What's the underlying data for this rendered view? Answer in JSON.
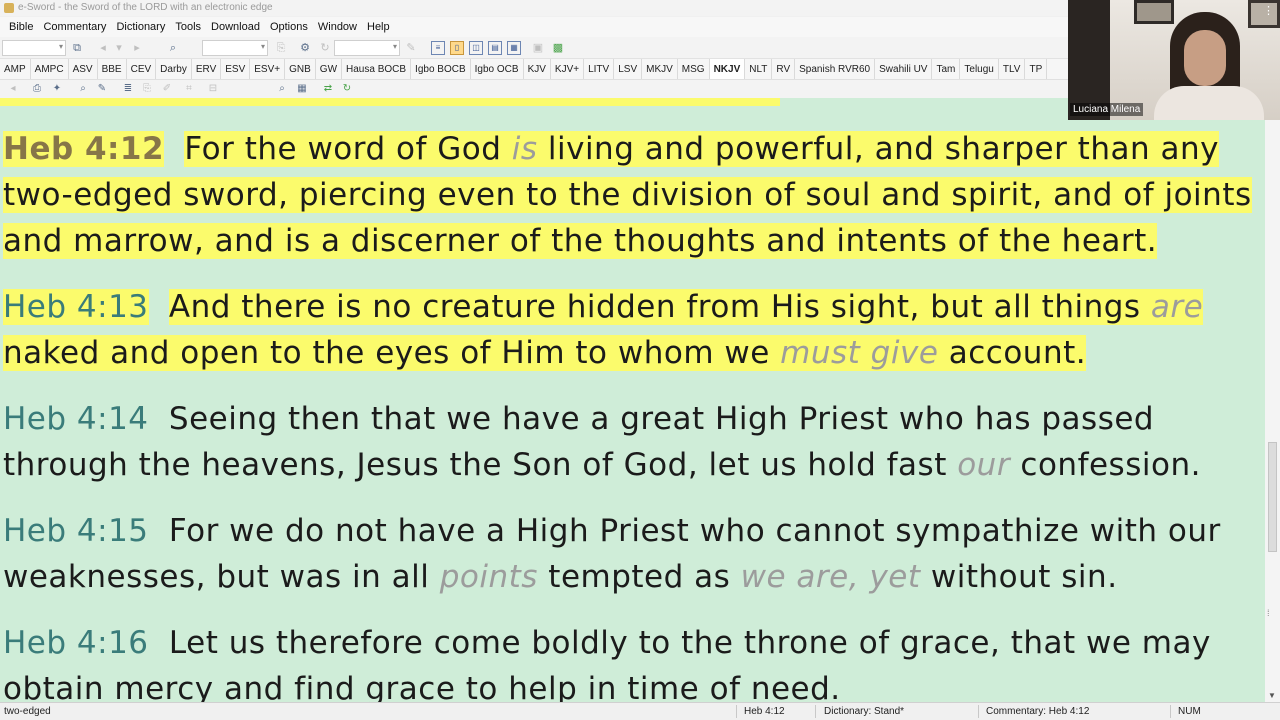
{
  "window": {
    "title": "e-Sword - the Sword of the LORD with an electronic edge"
  },
  "menu": [
    "Bible",
    "Commentary",
    "Dictionary",
    "Tools",
    "Download",
    "Options",
    "Window",
    "Help"
  ],
  "bible_tabs": [
    "AMP",
    "AMPC",
    "ASV",
    "BBE",
    "CEV",
    "Darby",
    "ERV",
    "ESV",
    "ESV+",
    "GNB",
    "GW",
    "Hausa BOCB",
    "Igbo BOCB",
    "Igbo OCB",
    "KJV",
    "KJV+",
    "LITV",
    "LSV",
    "MKJV",
    "MSG",
    "NKJV",
    "NLT",
    "RV",
    "Spanish RVR60",
    "Swahili UV",
    "Tam",
    "Telugu",
    "TLV",
    "TP"
  ],
  "active_tab": "NKJV",
  "verses": [
    {
      "ref": "Heb 4:12",
      "segments": [
        {
          "text": "For the word of God ",
          "italic": false
        },
        {
          "text": "is",
          "italic": true
        },
        {
          "text": " living and powerful, and sharper than any two-edged sword, piercing even to the division of soul and spirit, and of joints and marrow, and is a discerner of the thoughts and intents of the heart.",
          "italic": false
        }
      ]
    },
    {
      "ref": "Heb 4:13",
      "segments": [
        {
          "text": "And there is no creature hidden from His sight, but all things ",
          "italic": false
        },
        {
          "text": "are",
          "italic": true
        },
        {
          "text": " naked and open to the eyes of Him to whom we ",
          "italic": false
        },
        {
          "text": "must give",
          "italic": true
        },
        {
          "text": " account.",
          "italic": false
        }
      ]
    },
    {
      "ref": "Heb 4:14",
      "segments": [
        {
          "text": "Seeing then that we have a great High Priest who has passed through the heavens, Jesus the Son of God, let us hold fast ",
          "italic": false
        },
        {
          "text": "our",
          "italic": true
        },
        {
          "text": " confession.",
          "italic": false
        }
      ]
    },
    {
      "ref": "Heb 4:15",
      "segments": [
        {
          "text": "For we do not have a High Priest who cannot sympathize with our weaknesses, but was in all ",
          "italic": false
        },
        {
          "text": "points",
          "italic": true
        },
        {
          "text": " tempted as ",
          "italic": false
        },
        {
          "text": "we are, yet",
          "italic": true
        },
        {
          "text": " without sin.",
          "italic": false
        }
      ]
    },
    {
      "ref": "Heb 4:16",
      "segments": [
        {
          "text": "Let us therefore come boldly to the throne of grace, that we may obtain mercy and find grace to help in time of need.",
          "italic": false
        }
      ]
    }
  ],
  "statusbar": {
    "word": "two-edged",
    "reference": "Heb 4:12",
    "dictionary": "Dictionary: Stand*",
    "commentary": "Commentary: Heb 4:12",
    "num": "NUM"
  },
  "video": {
    "participant": "Luciana Milena"
  },
  "colors": {
    "highlight": "#fbfb6c",
    "background": "#cfedd8",
    "ref": "#3a7c7a",
    "current_ref": "#877648",
    "italic": "#9c9c9c"
  }
}
